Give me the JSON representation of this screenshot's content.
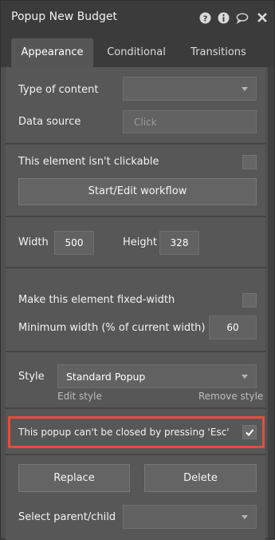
{
  "header": {
    "title": "Popup New Budget",
    "icons": [
      "help-icon",
      "info-icon",
      "comment-icon",
      "close-icon"
    ]
  },
  "tabs": [
    {
      "label": "Appearance",
      "active": true
    },
    {
      "label": "Conditional",
      "active": false
    },
    {
      "label": "Transitions",
      "active": false
    }
  ],
  "form": {
    "type_of_content_label": "Type of content",
    "type_of_content_value": "",
    "data_source_label": "Data source",
    "data_source_placeholder": "Click",
    "not_clickable_label": "This element isn't clickable",
    "not_clickable_checked": false,
    "workflow_button": "Start/Edit workflow",
    "width_label": "Width",
    "width_value": "500",
    "height_label": "Height",
    "height_value": "328",
    "fixed_width_label": "Make this element fixed-width",
    "fixed_width_checked": false,
    "min_width_label": "Minimum width (% of current width)",
    "min_width_value": "60",
    "style_label": "Style",
    "style_value": "Standard Popup",
    "edit_style_link": "Edit style",
    "remove_style_link": "Remove style",
    "esc_label": "This popup can't be closed by pressing 'Esc'",
    "esc_checked": true,
    "replace_button": "Replace",
    "delete_button": "Delete",
    "select_parent_label": "Select parent/child",
    "select_parent_value": ""
  },
  "colors": {
    "highlight": "#e74c3c",
    "panel_bg": "#575757",
    "titlebar_bg": "#3b3b3b"
  }
}
